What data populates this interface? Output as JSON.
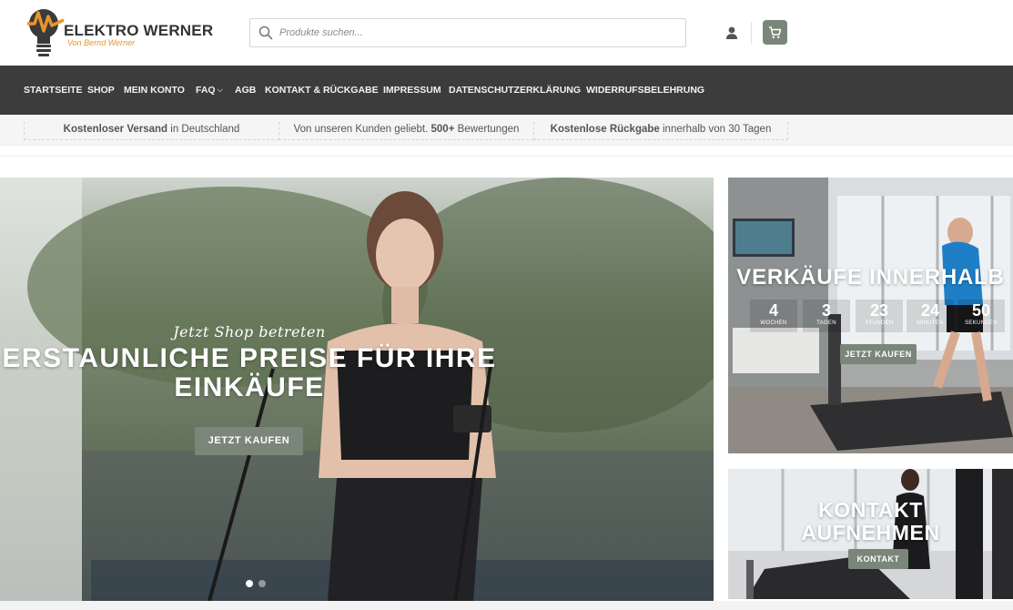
{
  "brand": {
    "name": "ELEKTRO WERNER",
    "tagline": "Von Bernd Werner",
    "accent": "#e9942b"
  },
  "search": {
    "placeholder": "Produkte suchen..."
  },
  "header_icons": [
    "search-icon",
    "user-icon",
    "cart-icon"
  ],
  "nav": {
    "items": [
      {
        "label": "STARTSEITE"
      },
      {
        "label": "SHOP"
      },
      {
        "label": "MEIN KONTO"
      },
      {
        "label": "FAQ"
      },
      {
        "label": "AGB"
      },
      {
        "label": "KONTAKT & RÜCKGABE"
      },
      {
        "label": "IMPRESSUM"
      },
      {
        "label": "DATENSCHUTZERKLÄRUNG"
      },
      {
        "label": "WIDERRUFSBELEHRUNG"
      }
    ]
  },
  "infobar": {
    "items": [
      {
        "bold": "Kostenloser Versand",
        "text": " in Deutschland"
      },
      {
        "lead": "Von unseren Kunden geliebt. ",
        "bold": "500+",
        "text": " Bewertungen"
      },
      {
        "bold": "Kostenlose Rückgabe",
        "text": " innerhalb von 30 Tagen"
      }
    ]
  },
  "hero": {
    "script": "Jetzt Shop betreten",
    "title": "ERSTAUNLICHE PREISE FÜR IHRE EINKÄUFE",
    "button": "JETZT KAUFEN",
    "slides_total": 2,
    "active_slide": 1
  },
  "sale_banner": {
    "title": "VERKÄUFE INNERHALB",
    "countdown": [
      {
        "value": "4",
        "label": "WOCHEN"
      },
      {
        "value": "3",
        "label": "TAGEN"
      },
      {
        "value": "23",
        "label": "STUNDEN"
      },
      {
        "value": "24",
        "label": "MINUTEN"
      },
      {
        "value": "50",
        "label": "SEKUNDEN"
      }
    ],
    "button": "JETZT KAUFEN"
  },
  "contact_banner": {
    "title_line1": "KONTAKT",
    "title_line2": "AUFNEHMEN",
    "button": "KONTAKT"
  },
  "colors": {
    "nav_bg": "#3c3c3c",
    "button": "#7a8679",
    "infobar_bg": "#f5f5f5"
  }
}
